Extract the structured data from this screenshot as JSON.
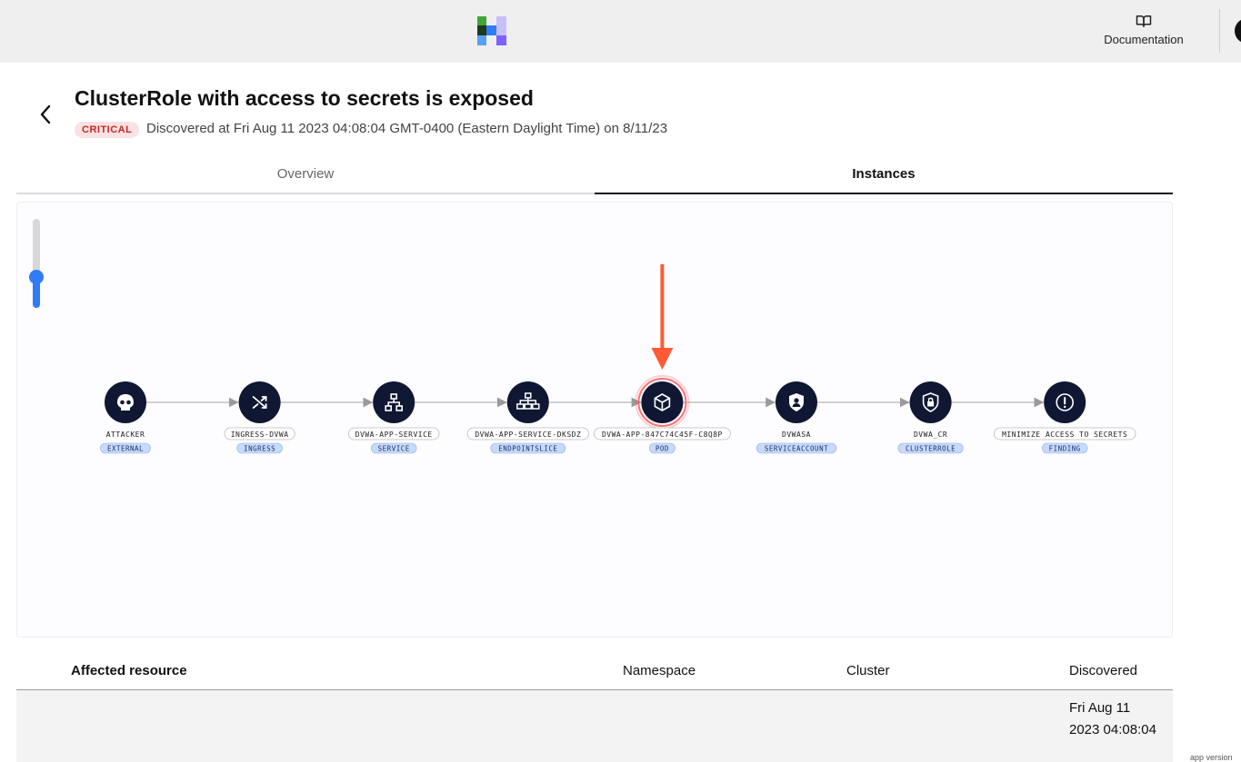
{
  "header": {
    "documentation_label": "Documentation",
    "colors": {
      "logo_green": "#3fa535",
      "logo_blue": "#2f7cf6",
      "logo_purple": "#7b61ff",
      "logo_dark": "#1e3a1e",
      "logo_lilac": "#c9bffb"
    }
  },
  "finding": {
    "title": "ClusterRole with access to secrets is exposed",
    "severity": "CRITICAL",
    "discovered_text": "Discovered at Fri Aug 11 2023 04:08:04 GMT-0400 (Eastern Daylight Time) on 8/11/23"
  },
  "tabs": [
    {
      "label": "Overview",
      "active": false
    },
    {
      "label": "Instances",
      "active": true
    }
  ],
  "zoom": {
    "level": 0.35
  },
  "graph": {
    "colors": {
      "node_fill": "#0f1733",
      "node_highlight_ring": "#ff4d4d",
      "edge": "#b5b5b5",
      "type_badge": "#c8dafa",
      "arrow": "#ff5a36"
    },
    "highlighted_node": 4,
    "nodes": [
      {
        "name": "ATTACKER",
        "type": "EXTERNAL",
        "icon": "skull-icon"
      },
      {
        "name": "INGRESS-DVWA",
        "type": "INGRESS",
        "icon": "shuffle-icon"
      },
      {
        "name": "DVWA-APP-SERVICE",
        "type": "SERVICE",
        "icon": "hierarchy-icon"
      },
      {
        "name": "DVWA-APP-SERVICE-DKSDZ",
        "type": "ENDPOINTSLICE",
        "icon": "network-icon"
      },
      {
        "name": "DVWA-APP-847C74C45F-C8Q8P",
        "type": "POD",
        "icon": "cube-icon"
      },
      {
        "name": "DVWASA",
        "type": "SERVICEACCOUNT",
        "icon": "user-shield-icon"
      },
      {
        "name": "DVWA_CR",
        "type": "CLUSTERROLE",
        "icon": "lock-shield-icon"
      },
      {
        "name": "MINIMIZE ACCESS TO SECRETS",
        "type": "FINDING",
        "icon": "alert-icon"
      }
    ]
  },
  "table": {
    "columns": [
      "Affected resource",
      "Namespace",
      "Cluster",
      "Discovered"
    ],
    "rows": [
      {
        "resource": "",
        "namespace": "",
        "cluster": "",
        "discovered": "Fri Aug 11 2023 04:08:04"
      }
    ]
  },
  "footer": {
    "app_version_label": "app version"
  }
}
